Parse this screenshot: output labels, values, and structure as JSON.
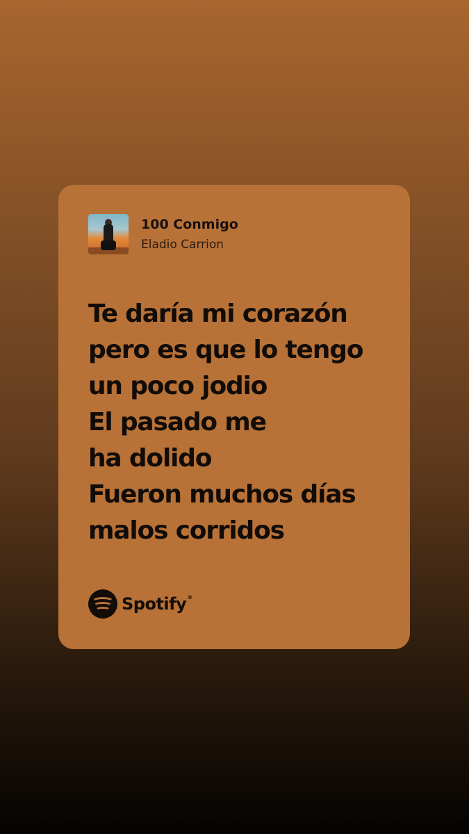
{
  "track": {
    "title": "100 Conmigo",
    "artist": "Eladio Carrion"
  },
  "lyrics": [
    "Te daría mi corazón",
    "pero es que lo tengo",
    "un poco jodio",
    "El pasado me",
    "ha dolido",
    "Fueron muchos días",
    "malos corridos"
  ],
  "brand": {
    "name": "Spotify",
    "icon": "spotify-logo-icon"
  },
  "colors": {
    "card_background": "#b87238",
    "text": "#120c08"
  }
}
